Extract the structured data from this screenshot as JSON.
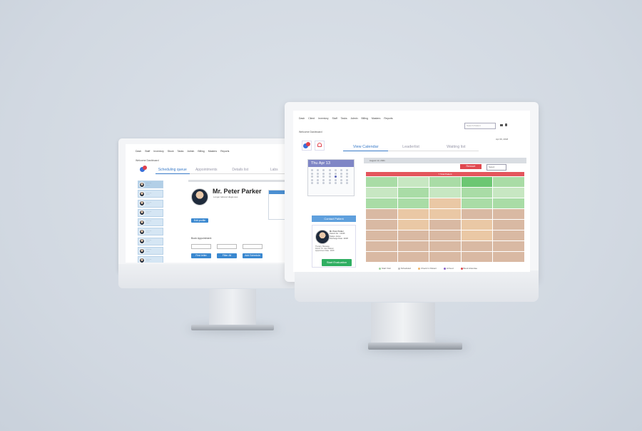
{
  "back_screen": {
    "nav_items": [
      "Dash",
      "Staff",
      "Inventory",
      "Stock",
      "Tasks",
      "Admin",
      "Billing",
      "Masters",
      "Reports"
    ],
    "page_title": "Welcome Dashboard",
    "tabs": [
      "Scheduling queue",
      "Appointments",
      "Details list",
      "Labs"
    ],
    "doctor_name": "Mr. Peter Parker",
    "doctor_subtitle": "Longer tailored diagnoses",
    "book_label": "Book Appointment",
    "buttons": [
      "First letter",
      "Filter All",
      "Add Schedule"
    ],
    "edit_btn": "Edit profile"
  },
  "front_screen": {
    "nav_items": [
      "Dash",
      "Client",
      "Inventory",
      "Staff",
      "Tasks",
      "Admin",
      "Billing",
      "Masters",
      "Reports"
    ],
    "search_placeholder": "Search Patient",
    "date": "Apr 09, 2018",
    "page_title": "Welcome Dashboard",
    "tabs": [
      "View Calendar",
      "Leaderlist",
      "Waiting list"
    ],
    "calendar_title": "Thu Apr 13",
    "contact_button": "Contact Patient",
    "patient_name": "Mr. Peter Parker",
    "patient_lines": [
      "Patient No.: 12345",
      "Status: Active",
      "Discharge Date: 10/08"
    ],
    "patient_more": [
      "Therapy: Massage",
      "Doctor: Dr. Jane Watson",
      "Appointment Date: 10/08"
    ],
    "start_button": "Start Evaluation",
    "schedule_header": "August 13, 2021",
    "remove_button": "Remove",
    "select_value": "Select",
    "slot_banner": "7 Total Patient",
    "legend": [
      {
        "label": "Start Visit",
        "color": "#9bd39b"
      },
      {
        "label": "Scheduled",
        "color": "#bfbfbf"
      },
      {
        "label": "Check In Patient",
        "color": "#f0b466"
      },
      {
        "label": "Arrived",
        "color": "#8a63c8"
      },
      {
        "label": "Book Attendee",
        "color": "#e0484f"
      }
    ]
  }
}
